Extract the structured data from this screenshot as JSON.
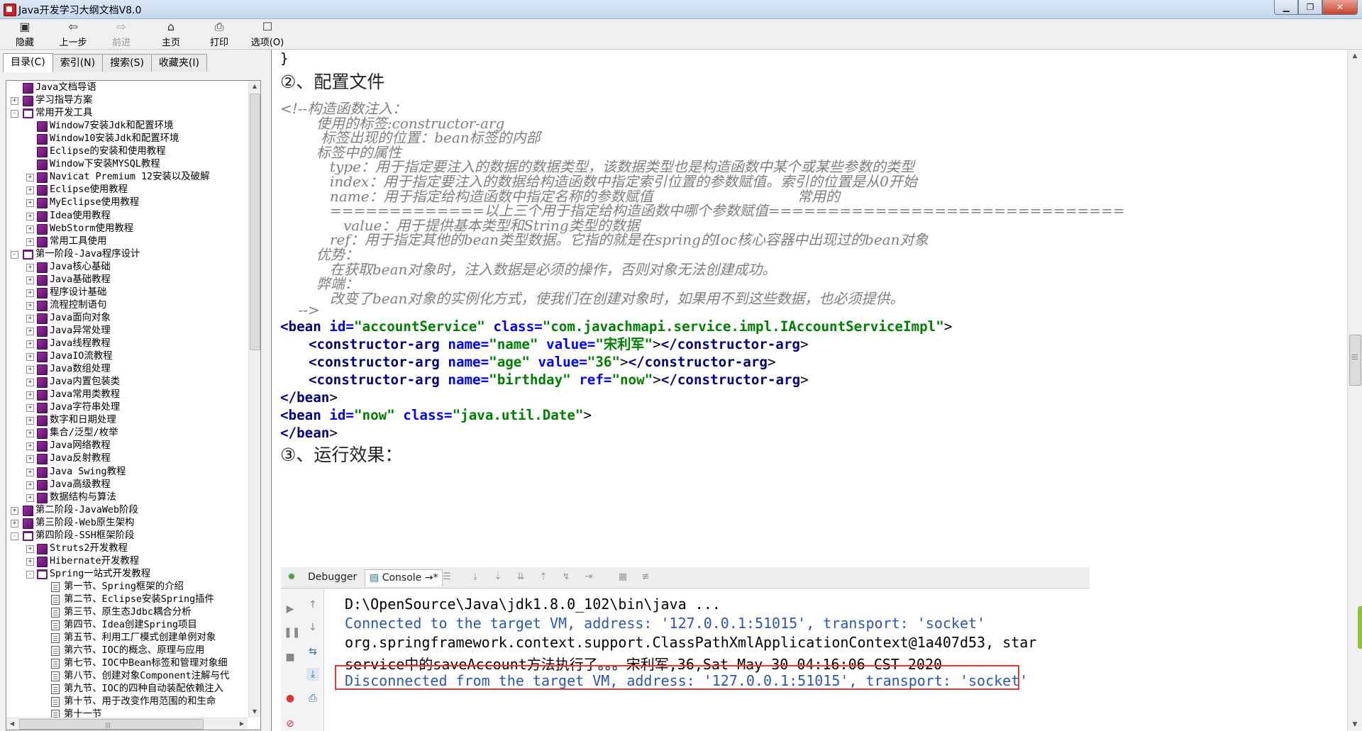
{
  "window": {
    "title": "Java开发学习大纲文档V8.0"
  },
  "toolbar": {
    "items": [
      {
        "label": "隐藏",
        "icon": "hide-icon",
        "glyph": "▣"
      },
      {
        "label": "上一步",
        "icon": "back-icon",
        "glyph": "⇦"
      },
      {
        "label": "前进",
        "icon": "forward-icon",
        "glyph": "⇨"
      },
      {
        "label": "主页",
        "icon": "home-icon",
        "glyph": "⌂"
      },
      {
        "label": "打印",
        "icon": "print-icon",
        "glyph": "⎙"
      },
      {
        "label": "选项(O)",
        "icon": "options-icon",
        "glyph": "☐"
      }
    ]
  },
  "nav_tabs": [
    "目录(C)",
    "索引(N)",
    "搜索(S)",
    "收藏夹(I)"
  ],
  "tree": [
    {
      "text": "Java文档导语",
      "level": 1,
      "icon": "book",
      "exp": ""
    },
    {
      "text": "学习指导方案",
      "level": 1,
      "icon": "book",
      "exp": "+"
    },
    {
      "text": "常用开发工具",
      "level": 1,
      "icon": "open",
      "exp": "-"
    },
    {
      "text": "Window7安装Jdk和配置环境",
      "level": 2,
      "icon": "book",
      "exp": ""
    },
    {
      "text": "Window10安装Jdk和配置环境",
      "level": 2,
      "icon": "book",
      "exp": ""
    },
    {
      "text": "Eclipse的安装和使用教程",
      "level": 2,
      "icon": "book",
      "exp": ""
    },
    {
      "text": "Window下安装MYSQL教程",
      "level": 2,
      "icon": "book",
      "exp": ""
    },
    {
      "text": "Navicat Premium 12安装以及破解",
      "level": 2,
      "icon": "book",
      "exp": "+"
    },
    {
      "text": "Eclipse使用教程",
      "level": 2,
      "icon": "book",
      "exp": "+"
    },
    {
      "text": "MyEclipse使用教程",
      "level": 2,
      "icon": "book",
      "exp": "+"
    },
    {
      "text": "Idea使用教程",
      "level": 2,
      "icon": "book",
      "exp": "+"
    },
    {
      "text": "WebStorm使用教程",
      "level": 2,
      "icon": "book",
      "exp": "+"
    },
    {
      "text": "常用工具使用",
      "level": 2,
      "icon": "book",
      "exp": "+"
    },
    {
      "text": "第一阶段-Java程序设计",
      "level": 1,
      "icon": "open",
      "exp": "-"
    },
    {
      "text": "Java核心基础",
      "level": 2,
      "icon": "book",
      "exp": "+"
    },
    {
      "text": "Java基础教程",
      "level": 2,
      "icon": "book",
      "exp": "+"
    },
    {
      "text": "程序设计基础",
      "level": 2,
      "icon": "book",
      "exp": "+"
    },
    {
      "text": "流程控制语句",
      "level": 2,
      "icon": "book",
      "exp": "+"
    },
    {
      "text": "Java面向对象",
      "level": 2,
      "icon": "book",
      "exp": "+"
    },
    {
      "text": "Java异常处理",
      "level": 2,
      "icon": "book",
      "exp": "+"
    },
    {
      "text": "Java线程教程",
      "level": 2,
      "icon": "book",
      "exp": "+"
    },
    {
      "text": "JavaIO流教程",
      "level": 2,
      "icon": "book",
      "exp": "+"
    },
    {
      "text": "Java数组处理",
      "level": 2,
      "icon": "book",
      "exp": "+"
    },
    {
      "text": "Java内置包装类",
      "level": 2,
      "icon": "book",
      "exp": "+"
    },
    {
      "text": "Java常用类教程",
      "level": 2,
      "icon": "book",
      "exp": "+"
    },
    {
      "text": "Java字符串处理",
      "level": 2,
      "icon": "book",
      "exp": "+"
    },
    {
      "text": "数字和日期处理",
      "level": 2,
      "icon": "book",
      "exp": "+"
    },
    {
      "text": "集合/泛型/枚举",
      "level": 2,
      "icon": "book",
      "exp": "+"
    },
    {
      "text": "Java网络教程",
      "level": 2,
      "icon": "book",
      "exp": "+"
    },
    {
      "text": "Java反射教程",
      "level": 2,
      "icon": "book",
      "exp": "+"
    },
    {
      "text": "Java Swing教程",
      "level": 2,
      "icon": "book",
      "exp": "+"
    },
    {
      "text": "Java高级教程",
      "level": 2,
      "icon": "book",
      "exp": "+"
    },
    {
      "text": "数据结构与算法",
      "level": 2,
      "icon": "book",
      "exp": "+"
    },
    {
      "text": "第二阶段-JavaWeb阶段",
      "level": 1,
      "icon": "book",
      "exp": "+"
    },
    {
      "text": "第三阶段-Web原生架构",
      "level": 1,
      "icon": "book",
      "exp": "+"
    },
    {
      "text": "第四阶段-SSH框架阶段",
      "level": 1,
      "icon": "open",
      "exp": "-"
    },
    {
      "text": "Struts2开发教程",
      "level": 2,
      "icon": "book",
      "exp": "+"
    },
    {
      "text": "Hibernate开发教程",
      "level": 2,
      "icon": "book",
      "exp": "+"
    },
    {
      "text": "Spring一站式开发教程",
      "level": 2,
      "icon": "open",
      "exp": "-"
    },
    {
      "text": "第一节、Spring框架的介绍",
      "level": 3,
      "icon": "page",
      "exp": ""
    },
    {
      "text": "第二节、Eclipse安装Spring插件",
      "level": 3,
      "icon": "page",
      "exp": ""
    },
    {
      "text": "第三节、原生态Jdbc耦合分析",
      "level": 3,
      "icon": "page",
      "exp": ""
    },
    {
      "text": "第四节、Idea创建Spring项目",
      "level": 3,
      "icon": "page",
      "exp": ""
    },
    {
      "text": "第五节、利用工厂模式创建单例对象",
      "level": 3,
      "icon": "page",
      "exp": ""
    },
    {
      "text": "第六节、IOC的概念、原理与应用",
      "level": 3,
      "icon": "page",
      "exp": ""
    },
    {
      "text": "第七节、IOC中Bean标签和管理对象细",
      "level": 3,
      "icon": "page",
      "exp": ""
    },
    {
      "text": "第八节、创建对象Component注解与代",
      "level": 3,
      "icon": "page",
      "exp": ""
    },
    {
      "text": "第九节、IOC的四种自动装配依赖注入",
      "level": 3,
      "icon": "page",
      "exp": ""
    },
    {
      "text": "第十节、用于改变作用范围的和生命",
      "level": 3,
      "icon": "page",
      "exp": ""
    },
    {
      "text": "第十一节",
      "level": 3,
      "icon": "page",
      "exp": ""
    }
  ],
  "doc": {
    "brace": "}",
    "heading2": "②、配置文件",
    "comment_lines": [
      "<!--构造函数注入：",
      "        使用的标签:constructor-arg",
      "         标签出现的位置：bean标签的内部",
      "        标签中的属性",
      "           type：用于指定要注入的数据的数据类型，该数据类型也是构造函数中某个或某些参数的类型",
      "           index：用于指定要注入的数据给构造函数中指定索引位置的参数赋值。索引的位置是从0开始",
      "           name：用于指定给构造函数中指定名称的参数赋值                                常用的",
      "           =============以上三个用于指定给构造函数中哪个参数赋值==============================",
      "              value：用于提供基本类型和String类型的数据",
      "           ref：用于指定其他的bean类型数据。它指的就是在spring的Ioc核心容器中出现过的bean对象",
      "        优势：",
      "           在获取bean对象时，注入数据是必须的操作，否则对象无法创建成功。",
      "        弊端：",
      "           改变了bean对象的实例化方式，使我们在创建对象时，如果用不到这些数据，也必须提供。",
      "    -->"
    ],
    "xml": {
      "bean1_open": "<bean",
      "bean1_id_attr": " id=",
      "bean1_id_val": "\"accountService\"",
      "bean1_class_attr": " class=",
      "bean1_class_val": "\"com.javachmapi.service.impl.IAccountServiceImpl\"",
      "gt": ">",
      "carg_open": "<constructor-arg",
      "carg_close": "</constructor-arg",
      "name_attr": " name=",
      "value_attr": " value=",
      "ref_attr": " ref=",
      "arg1_name": "\"name\"",
      "arg1_value": "\"宋利军\"",
      "arg2_name": "\"age\"",
      "arg2_value": "\"36\"",
      "arg3_name": "\"birthday\"",
      "arg3_ref": "\"now\"",
      "bean_close": "</bean",
      "bean2_open": "<bean",
      "bean2_id_val": "\"now\"",
      "bean2_class_val": "\"java.util.Date\""
    },
    "heading3": "③、运行效果："
  },
  "ide": {
    "tab_debugger": "Debugger",
    "tab_console": "Console",
    "tab_console_suffix": "→*",
    "lines": [
      {
        "text": "D:\\OpenSource\\Java\\jdk1.8.0_102\\bin\\java ...",
        "color": "#000000"
      },
      {
        "text": "Connected to the target VM, address: '127.0.0.1:51015', transport: 'socket'",
        "color": "#2a56b8"
      },
      {
        "text": "org.springframework.context.support.ClassPathXmlApplicationContext@1a407d53, star",
        "color": "#000000"
      },
      {
        "text": "service中的saveAccount方法执行了。。。宋利军,36,Sat May 30 04:16:06 CST 2020",
        "color": "#000000"
      },
      {
        "text": "Disconnected from the target VM, address: '127.0.0.1:51015', transport: 'socket'",
        "color": "#2a56b8"
      }
    ]
  },
  "colors": {
    "tag": "#000080",
    "attr": "#0000ff",
    "value": "#008000",
    "comment": "#7f7f7f",
    "highlight_box": "#e53935"
  }
}
